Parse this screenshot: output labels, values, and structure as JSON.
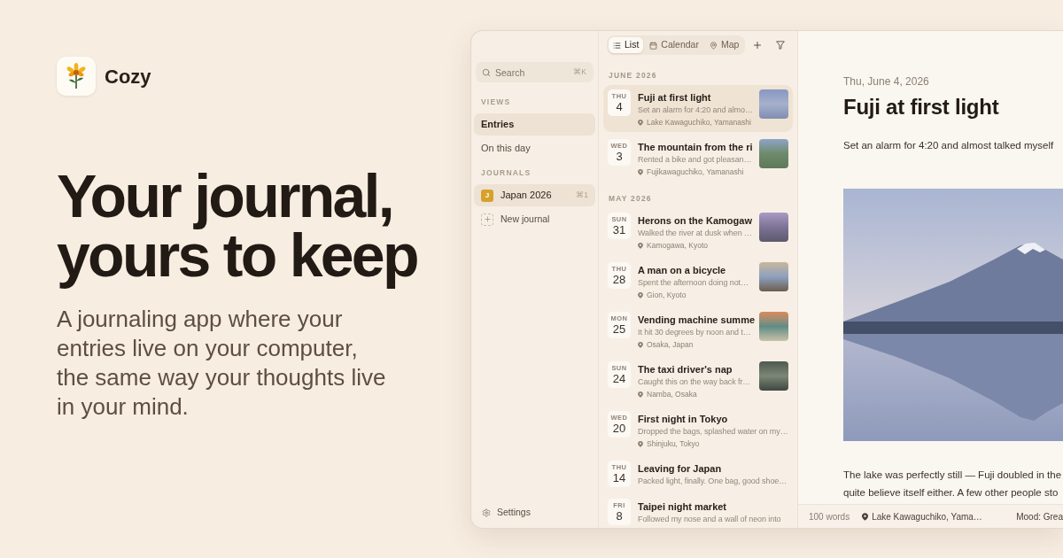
{
  "brand": {
    "name": "Cozy"
  },
  "hero": {
    "headline": "Your journal, yours to keep",
    "description": "A journaling app where your entries live on your computer, the same way your thoughts live in your mind."
  },
  "app": {
    "sidebar": {
      "search": {
        "placeholder": "Search",
        "shortcut": "⌘K"
      },
      "views": {
        "heading": "VIEWS",
        "items": [
          {
            "label": "Entries",
            "selected": true
          },
          {
            "label": "On this day",
            "selected": false
          }
        ]
      },
      "journals": {
        "heading": "JOURNALS",
        "items": [
          {
            "initial": "J",
            "label": "Japan 2026",
            "shortcut": "⌘1",
            "color": "#d6a12b",
            "selected": true
          }
        ],
        "new_journal": "New journal"
      },
      "settings": "Settings"
    },
    "entry_list": {
      "view_tabs": [
        {
          "label": "List",
          "selected": true
        },
        {
          "label": "Calendar",
          "selected": false
        },
        {
          "label": "Map",
          "selected": false
        }
      ],
      "groups": [
        {
          "heading": "JUNE 2026",
          "entries": [
            {
              "weekday": "THU",
              "day": "4",
              "title": "Fuji at first light",
              "excerpt": "Set an alarm for 4:20 and almo…",
              "location": "Lake Kawaguchiko, Yamanashi",
              "photo": true,
              "selected": true
            },
            {
              "weekday": "WED",
              "day": "3",
              "title": "The mountain from the ri",
              "excerpt": "Rented a bike and got pleasan…",
              "location": "Fujikawaguchiko, Yamanashi",
              "photo": true,
              "selected": false
            }
          ]
        },
        {
          "heading": "MAY 2026",
          "entries": [
            {
              "weekday": "SUN",
              "day": "31",
              "title": "Herons on the Kamogaw",
              "excerpt": "Walked the river at dusk when …",
              "location": "Kamogawa, Kyoto",
              "photo": true,
              "selected": false
            },
            {
              "weekday": "THU",
              "day": "28",
              "title": "A man on a bicycle",
              "excerpt": "Spent the afternoon doing not…",
              "location": "Gion, Kyoto",
              "photo": true,
              "selected": false
            },
            {
              "weekday": "MON",
              "day": "25",
              "title": "Vending machine summe",
              "excerpt": "It hit 30 degrees by noon and t…",
              "location": "Osaka, Japan",
              "photo": true,
              "selected": false
            },
            {
              "weekday": "SUN",
              "day": "24",
              "title": "The taxi driver's nap",
              "excerpt": "Caught this on the way back fr…",
              "location": "Namba, Osaka",
              "photo": true,
              "selected": false
            },
            {
              "weekday": "WED",
              "day": "20",
              "title": "First night in Tokyo",
              "excerpt": "Dropped the bags, splashed water on my…",
              "location": "Shinjuku, Tokyo",
              "photo": false,
              "selected": false
            },
            {
              "weekday": "THU",
              "day": "14",
              "title": "Leaving for Japan",
              "excerpt": "Packed light, finally. One bag, good shoe…",
              "photo": false,
              "selected": false
            },
            {
              "weekday": "FRI",
              "day": "8",
              "title": "Taipei night market",
              "excerpt": "Followed my nose and a wall of neon into",
              "photo": false,
              "selected": false
            }
          ]
        }
      ]
    },
    "detail": {
      "date": "Thu, June 4, 2026",
      "title": "Fuji at first light",
      "lead": "Set an alarm for 4:20 and almost talked myself",
      "body_lines": [
        "The lake was perfectly still — Fuji doubled in the",
        "quite believe itself either. A few other people sto"
      ],
      "status_bar": {
        "word_count": "100 words",
        "location": "Lake Kawaguchiko, Yama…",
        "mood": "Mood: Grea"
      }
    }
  }
}
